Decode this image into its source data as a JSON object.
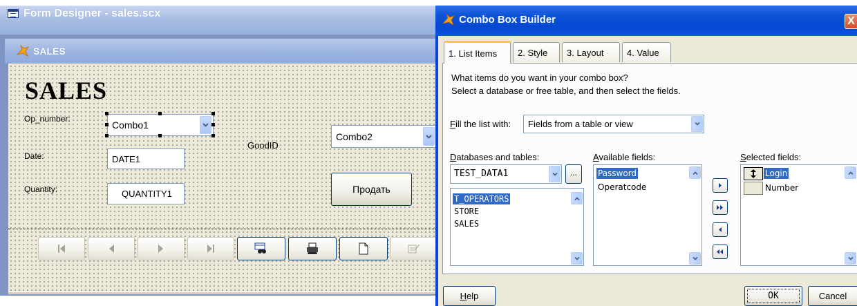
{
  "form_designer": {
    "title": "Form Designer - sales.scx",
    "form": {
      "title": "SALES",
      "heading": "SALES",
      "labels": {
        "op_number": "Op_number:",
        "date": "Date:",
        "quantity": "Quantity:",
        "good_id": "GoodID"
      },
      "combo1_value": "Combo1",
      "combo2_value": "Combo2",
      "date_field_value": "DATE1",
      "quantity_field_value": "QUANTITY1",
      "sell_button_label": "Продать"
    },
    "nav_buttons": [
      "first-record-icon",
      "previous-record-icon",
      "next-record-icon",
      "last-record-icon",
      "find-icon",
      "print-icon",
      "new-record-icon",
      "edit-icon"
    ]
  },
  "combo_builder": {
    "title": "Combo Box Builder",
    "close_label": "X",
    "tabs": [
      "1. List Items",
      "2. Style",
      "3. Layout",
      "4. Value"
    ],
    "active_tab": "1. List Items",
    "instructions_line1": "What items do you want in your combo box?",
    "instructions_line2": "Select a database or free table, and then select the fields.",
    "fill_label_accel": "F",
    "fill_label_rest": "ill the list with:",
    "fill_value": "Fields from a table or view",
    "databases_label_accel": "D",
    "databases_label_rest": "atabases and tables:",
    "database_value": "TEST_DATA1",
    "browse_label": "...",
    "tables": [
      "T_OPERATORS",
      "STORE",
      "SALES"
    ],
    "selected_table": "T_OPERATORS",
    "available_label_accel": "A",
    "available_label_rest": "vailable fields:",
    "available_fields": [
      "Password",
      "Operatcode"
    ],
    "selected_available": "Password",
    "selected_label_accel": "S",
    "selected_label_rest": "elected fields:",
    "selected_fields": [
      "Login",
      "Number"
    ],
    "move_buttons": [
      "add-icon",
      "add-all-icon",
      "remove-icon",
      "remove-all-icon"
    ],
    "help_label_accel": "H",
    "help_label_rest": "elp",
    "ok_label": "OK",
    "cancel_label": "Cancel"
  },
  "colors": {
    "xp_title_blue": "#0a52d6",
    "inactive_title": "#9fb6e2",
    "selection": "#316ac5",
    "dialog_bg": "#ece9d8",
    "tab_highlight": "#ffc83c"
  }
}
